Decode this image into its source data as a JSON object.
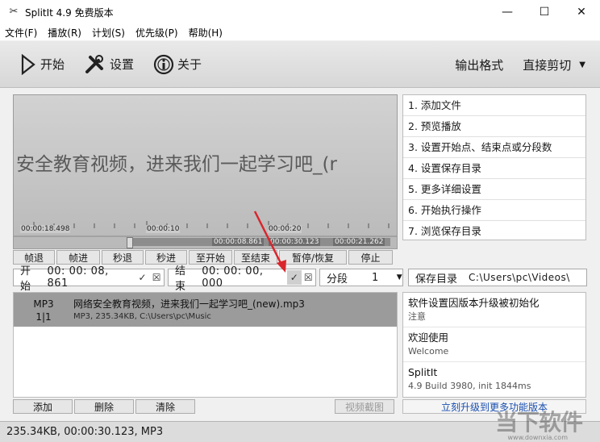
{
  "window": {
    "title": "SplitIt 4.9 免费版本",
    "minimize": "—",
    "maximize": "☐",
    "close": "✕"
  },
  "menu": [
    "文件(F)",
    "播放(R)",
    "计划(S)",
    "优先级(P)",
    "帮助(H)"
  ],
  "toolbar": {
    "start": "开始",
    "settings": "设置",
    "about": "关于",
    "output_format": "输出格式",
    "direct_cut": "直接剪切"
  },
  "preview": {
    "text": "安全教育视频，进来我们一起学习吧_(r",
    "current_time": "00:00:18.498",
    "tick1": "00:00:10",
    "tick2": "00:00:20",
    "marker_start": "00:00:08.861",
    "marker_total": "00:00:30.123",
    "marker_end": "00:00:21.262"
  },
  "controls": [
    "帧退",
    "帧进",
    "秒退",
    "秒进",
    "至开始",
    "至结束",
    "暂停/恢复",
    "停止"
  ],
  "start_field": {
    "label": "开始",
    "value": "00: 00: 08, 861"
  },
  "end_field": {
    "label": "结束",
    "value": "00: 00: 00, 000"
  },
  "segment": {
    "label": "分段",
    "value": "1"
  },
  "save_dir": {
    "label": "保存目录",
    "value": "C:\\Users\\pc\\Videos\\"
  },
  "steps": [
    "1. 添加文件",
    "2. 预览播放",
    "3. 设置开始点、结束点或分段数",
    "4. 设置保存目录",
    "5. 更多详细设置",
    "6. 开始执行操作",
    "7. 浏览保存目录"
  ],
  "file": {
    "type": "MP3",
    "index": "1|1",
    "name": "网络安全教育视频，进来我们一起学习吧_(new).mp3",
    "meta": "MP3, 235.34KB, C:\\Users\\pc\\Music"
  },
  "info": [
    {
      "title": "软件设置因版本升级被初始化",
      "sub": "注意"
    },
    {
      "title": "欢迎使用",
      "sub": "Welcome"
    },
    {
      "title": "SplitIt",
      "sub": "4.9 Build 3980, init 1844ms"
    }
  ],
  "bottom_buttons": {
    "add": "添加",
    "delete": "删除",
    "clear": "清除",
    "snapshot": "视频截图"
  },
  "upgrade": "立刻升级到更多功能版本",
  "status": "235.34KB, 00:00:30.123, MP3",
  "watermark": {
    "brand": "当下软件",
    "site": "www.downxia.com"
  },
  "colors": {
    "accent_link": "#1a4fb0",
    "arrow": "#d9262c"
  }
}
